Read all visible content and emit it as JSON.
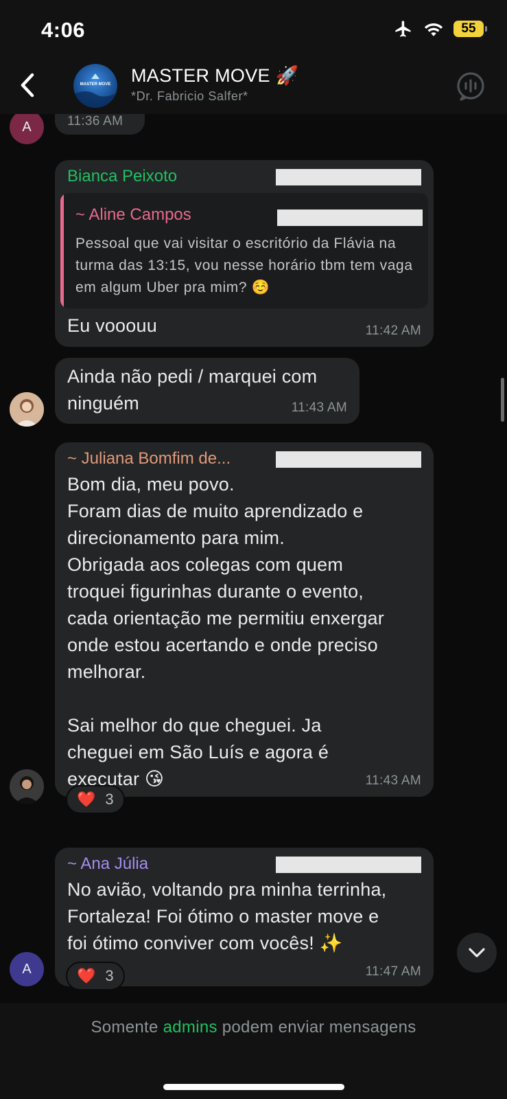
{
  "status_bar": {
    "time": "4:06",
    "battery": "55",
    "icons": [
      "airplane-icon",
      "wifi-icon",
      "battery-icon"
    ]
  },
  "header": {
    "title": "MASTER MOVE 🚀",
    "subtitle": "*Dr. Fabricio Salfer*",
    "avatar_text": "MASTER MOVE"
  },
  "messages": {
    "m0": {
      "time": "11:36 AM",
      "avatar_initial": "A"
    },
    "m1": {
      "sender": "Bianca Peixoto",
      "quote_sender": "~ Aline Campos",
      "quote_text": "Pessoal que vai visitar o escritório da Flávia na turma das 13:15, vou nesse horário tbm tem vaga em algum Uber pra mim? ☺️",
      "text": "Eu vooouu",
      "time": "11:42 AM"
    },
    "m2": {
      "text": "Ainda não pedi / marquei com\nninguém",
      "time": "11:43 AM"
    },
    "m3": {
      "sender": "~ Juliana Bomfim de...",
      "text": "Bom dia, meu povo.\nForam dias de muito aprendizado e\ndirecionamento para mim.\nObrigada aos colegas com quem\ntroquei figurinhas durante o evento,\ncada orientação me permitiu enxergar\nonde estou acertando e onde preciso\nmelhorar.\n\nSai melhor do que cheguei. Ja\ncheguei em São Luís e agora é\nexecutar 😘",
      "time": "11:43 AM",
      "reaction_emoji": "❤️",
      "reaction_count": "3"
    },
    "m4": {
      "sender": "~ Ana Júlia",
      "text": "No avião, voltando pra minha terrinha,\nFortaleza! Foi ótimo o master move e\nfoi ótimo conviver com vocês! ✨",
      "time": "11:47 AM",
      "avatar_initial": "A",
      "reaction_emoji": "❤️",
      "reaction_count": "3"
    }
  },
  "footer": {
    "notice_pre": "Somente ",
    "notice_admins": "admins",
    "notice_post": " podem enviar mensagens"
  },
  "colors": {
    "background": "#0b0b0b",
    "bubble": "#232526",
    "sender_bianca": "#21c063",
    "sender_aline": "#e86a8e",
    "sender_juliana": "#e39a7b",
    "sender_ana": "#a88df0",
    "accent_green": "#21c063"
  }
}
